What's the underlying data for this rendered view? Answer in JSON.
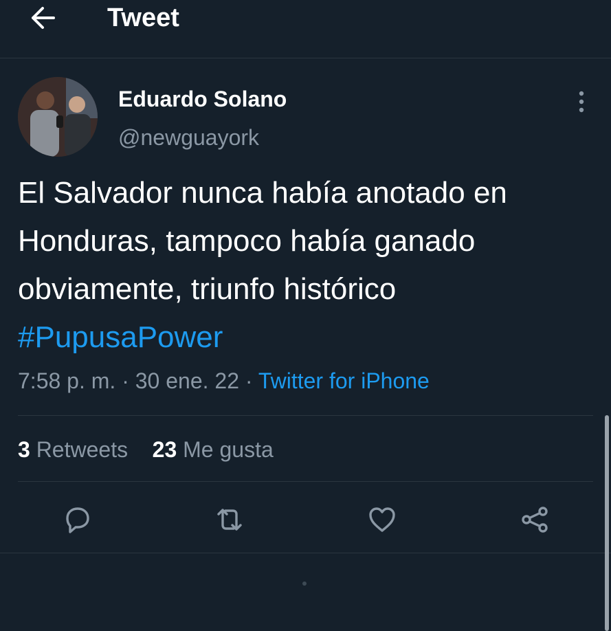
{
  "header": {
    "title": "Tweet",
    "back_icon": "arrow-left-icon"
  },
  "author": {
    "name": "Eduardo Solano",
    "handle": "@newguayork"
  },
  "tweet": {
    "text": "El Salvador nunca había anotado en Honduras, tampoco había ganado obviamente, triunfo histórico ",
    "hashtag": "#PupusaPower",
    "time": "7:58 p. m.",
    "date": "30 ene. 22",
    "separator": "·",
    "source": "Twitter for iPhone"
  },
  "stats": {
    "retweets_count": "3",
    "retweets_label": "Retweets",
    "likes_count": "23",
    "likes_label": "Me gusta"
  },
  "actions": [
    "reply-icon",
    "retweet-icon",
    "like-icon",
    "share-icon"
  ],
  "colors": {
    "background": "#15202b",
    "accent": "#1d9bf0",
    "secondary_text": "#8b98a5",
    "divider": "#2b3640"
  }
}
